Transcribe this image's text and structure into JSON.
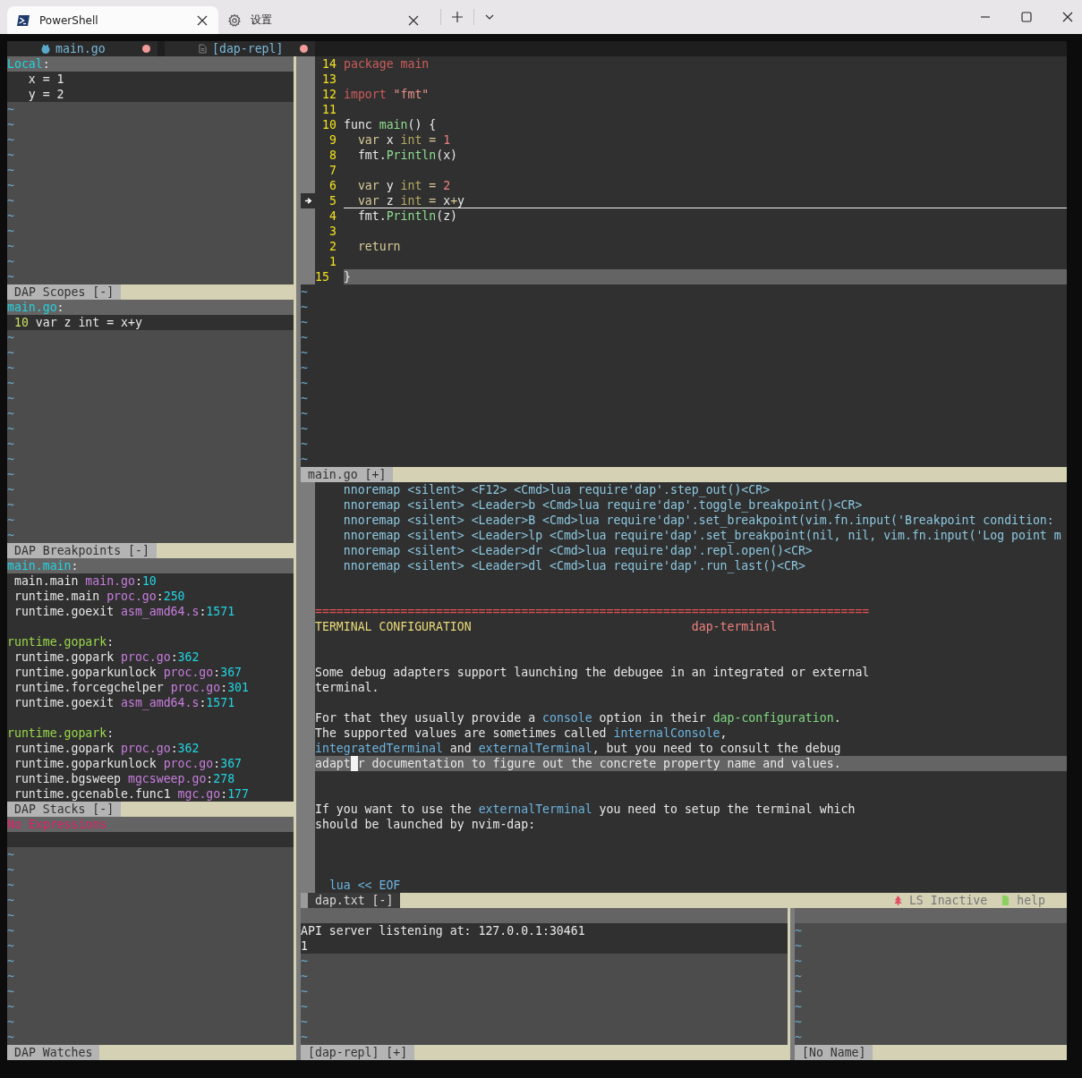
{
  "titlebar": {
    "tabs": [
      {
        "kind": "terminal",
        "label": "PowerShell",
        "selected": true
      },
      {
        "kind": "settings",
        "label": "设置",
        "selected": false
      }
    ]
  },
  "tabline": [
    {
      "kind": "go",
      "label": "main.go",
      "modified": true
    },
    {
      "kind": "doc",
      "label": "[dap-repl]",
      "modified": true
    }
  ],
  "left_panes": [
    {
      "lines": [
        {
          "segs": [
            {
              "t": "Local",
              "kind": "scope"
            },
            {
              "t": ":"
            }
          ],
          "cursorline": true
        },
        {
          "segs": [
            {
              "t": "   x = 1"
            }
          ],
          "cursorline": false
        },
        {
          "segs": [
            {
              "t": "   y = 2"
            }
          ],
          "cursorline": false
        }
      ],
      "filler": [
        "~",
        "~",
        "~",
        "~",
        "~",
        "~",
        "~",
        "~",
        "~",
        "~",
        "~",
        "~"
      ],
      "status": {
        "label": "DAP Scopes [-]",
        "active": false
      }
    },
    {
      "lines": [
        {
          "segs": [
            {
              "t": "main.go",
              "kind": "scope"
            },
            {
              "t": ":"
            }
          ],
          "cursorline": true
        },
        {
          "segs": [
            {
              "t": " 10",
              "kind": "lnr"
            },
            {
              "t": " var z int = x+y"
            }
          ],
          "cursorline": false
        }
      ],
      "filler": [
        "~",
        "~",
        "~",
        "~",
        "~",
        "~",
        "~",
        "~",
        "~",
        "~",
        "~",
        "~",
        "~",
        "~"
      ],
      "status": {
        "label": "DAP Breakpoints [-]",
        "active": false
      }
    },
    {
      "lines": [
        {
          "segs": [
            {
              "t": "main.main",
              "kind": "scope"
            },
            {
              "t": ":"
            }
          ],
          "cursorline": true
        },
        {
          "segs": [
            {
              "t": " main.main "
            },
            {
              "t": "main.go",
              "kind": "file"
            },
            {
              "t": ":"
            },
            {
              "t": "10",
              "kind": "lnum"
            }
          ],
          "cursorline": false
        },
        {
          "segs": [
            {
              "t": " runtime.main "
            },
            {
              "t": "proc.go",
              "kind": "file"
            },
            {
              "t": ":"
            },
            {
              "t": "250",
              "kind": "lnum"
            }
          ],
          "cursorline": false
        },
        {
          "segs": [
            {
              "t": " runtime.goexit "
            },
            {
              "t": "asm_amd64.s",
              "kind": "file"
            },
            {
              "t": ":"
            },
            {
              "t": "1571",
              "kind": "lnum"
            }
          ],
          "cursorline": false
        },
        {
          "cursorline": false
        },
        {
          "segs": [
            {
              "t": "runtime.gopark",
              "kind": "frame"
            },
            {
              "t": ":"
            }
          ],
          "cursorline": false
        },
        {
          "segs": [
            {
              "t": " runtime.gopark "
            },
            {
              "t": "proc.go",
              "kind": "file"
            },
            {
              "t": ":"
            },
            {
              "t": "362",
              "kind": "lnum"
            }
          ],
          "cursorline": false
        },
        {
          "segs": [
            {
              "t": " runtime.goparkunlock "
            },
            {
              "t": "proc.go",
              "kind": "file"
            },
            {
              "t": ":"
            },
            {
              "t": "367",
              "kind": "lnum"
            }
          ],
          "cursorline": false
        },
        {
          "segs": [
            {
              "t": " runtime.forcegchelper "
            },
            {
              "t": "proc.go",
              "kind": "file"
            },
            {
              "t": ":"
            },
            {
              "t": "301",
              "kind": "lnum"
            }
          ],
          "cursorline": false
        },
        {
          "segs": [
            {
              "t": " runtime.goexit "
            },
            {
              "t": "asm_amd64.s",
              "kind": "file"
            },
            {
              "t": ":"
            },
            {
              "t": "1571",
              "kind": "lnum"
            }
          ],
          "cursorline": false
        },
        {
          "cursorline": false
        },
        {
          "segs": [
            {
              "t": "runtime.gopark",
              "kind": "frame"
            },
            {
              "t": ":"
            }
          ],
          "cursorline": false
        },
        {
          "segs": [
            {
              "t": " runtime.gopark "
            },
            {
              "t": "proc.go",
              "kind": "file"
            },
            {
              "t": ":"
            },
            {
              "t": "362",
              "kind": "lnum"
            }
          ],
          "cursorline": false
        },
        {
          "segs": [
            {
              "t": " runtime.goparkunlock "
            },
            {
              "t": "proc.go",
              "kind": "file"
            },
            {
              "t": ":"
            },
            {
              "t": "367",
              "kind": "lnum"
            }
          ],
          "cursorline": false
        },
        {
          "segs": [
            {
              "t": " runtime.bgsweep "
            },
            {
              "t": "mgcsweep.go",
              "kind": "file"
            },
            {
              "t": ":"
            },
            {
              "t": "278",
              "kind": "lnum"
            }
          ],
          "cursorline": false
        },
        {
          "segs": [
            {
              "t": " runtime.gcenable.func1 "
            },
            {
              "t": "mgc.go",
              "kind": "file"
            },
            {
              "t": ":"
            },
            {
              "t": "177",
              "kind": "lnum"
            }
          ],
          "cursorline": false
        }
      ],
      "status": {
        "label": "DAP Stacks [-]",
        "active": false
      }
    },
    {
      "lines": [
        {
          "segs": [
            {
              "t": "No Expressions",
              "kind": "err"
            }
          ],
          "cursorline": true
        },
        {
          "cursorline": false
        }
      ],
      "filler": [
        "~",
        "~",
        "~",
        "~",
        "~",
        "~",
        "~",
        "~",
        "~",
        "~",
        "~",
        "~",
        "~"
      ],
      "status": {
        "label": "DAP Watches",
        "active": false
      }
    }
  ],
  "code_pane": {
    "lines": [
      {
        "num": "14",
        "segs": [
          {
            "t": "package main",
            "kind": "kw"
          }
        ],
        "cursorline": false,
        "stopped": false
      },
      {
        "num": "13",
        "cursorline": false,
        "stopped": false
      },
      {
        "num": "12",
        "segs": [
          {
            "t": "import ",
            "kind": "kw"
          },
          {
            "t": "\"fmt\"",
            "kind": "str"
          }
        ],
        "cursorline": false,
        "stopped": false
      },
      {
        "num": "11",
        "cursorline": false,
        "stopped": false
      },
      {
        "num": "10",
        "segs": [
          {
            "t": "func "
          },
          {
            "t": "main",
            "kind": "fn"
          },
          {
            "t": "() {"
          }
        ],
        "cursorline": false,
        "stopped": false
      },
      {
        "num": "9",
        "segs": [
          {
            "t": "  var",
            "kind": "key"
          },
          {
            "t": " x "
          },
          {
            "t": "int",
            "kind": "type"
          },
          {
            "t": " = ",
            "kind": "key"
          },
          {
            "t": "1",
            "kind": "num"
          }
        ],
        "cursorline": false,
        "stopped": false
      },
      {
        "num": "8",
        "segs": [
          {
            "t": "  fmt."
          },
          {
            "t": "Println",
            "kind": "fn"
          },
          {
            "t": "(x)"
          }
        ],
        "cursorline": false,
        "stopped": false
      },
      {
        "num": "7",
        "cursorline": false,
        "stopped": false
      },
      {
        "num": "6",
        "segs": [
          {
            "t": "  var",
            "kind": "key"
          },
          {
            "t": " y "
          },
          {
            "t": "int",
            "kind": "type"
          },
          {
            "t": " = ",
            "kind": "key"
          },
          {
            "t": "2",
            "kind": "num"
          }
        ],
        "cursorline": false,
        "stopped": false
      },
      {
        "num": "5",
        "segs": [
          {
            "t": "  var",
            "kind": "key"
          },
          {
            "t": " z "
          },
          {
            "t": "int",
            "kind": "type"
          },
          {
            "t": " = ",
            "kind": "key"
          },
          {
            "t": "x"
          },
          {
            "t": "+",
            "kind": "key"
          },
          {
            "t": "y"
          }
        ],
        "cursorline": false,
        "stopped": true
      },
      {
        "num": "4",
        "segs": [
          {
            "t": "  fmt."
          },
          {
            "t": "Println",
            "kind": "fn"
          },
          {
            "t": "(z)"
          }
        ],
        "cursorline": false,
        "stopped": false
      },
      {
        "num": "3",
        "cursorline": false,
        "stopped": false
      },
      {
        "num": "2",
        "segs": [
          {
            "t": "  return",
            "kind": "key"
          }
        ],
        "cursorline": false,
        "stopped": false
      },
      {
        "num": "1",
        "cursorline": false,
        "stopped": false
      },
      {
        "num": "15",
        "segs": [
          {
            "t": "}"
          }
        ],
        "cursorline": true,
        "stopped": false
      }
    ],
    "filler": [
      "~",
      "~",
      "~",
      "~",
      "~",
      "~",
      "~",
      "~",
      "~",
      "~",
      "~",
      "~"
    ],
    "status": {
      "label": "main.go [+]",
      "active": false
    }
  },
  "help_pane": {
    "lines": [
      {
        "segs": [
          {
            "t": "    nnoremap <silent> <F12> <Cmd>lua require'dap'.step_out()<CR>",
            "kind": "map"
          }
        ],
        "cursorline": false
      },
      {
        "segs": [
          {
            "t": "    nnoremap <silent> <Leader>b <Cmd>lua require'dap'.toggle_breakpoint()<CR>",
            "kind": "map"
          }
        ],
        "cursorline": false
      },
      {
        "segs": [
          {
            "t": "    nnoremap <silent> <Leader>B <Cmd>lua require'dap'.set_breakpoint(vim.fn.input('Breakpoint condition:",
            "kind": "map"
          }
        ],
        "cursorline": false
      },
      {
        "segs": [
          {
            "t": "    nnoremap <silent> <Leader>lp <Cmd>lua require'dap'.set_breakpoint(nil, nil, vim.fn.input('Log point m",
            "kind": "map"
          }
        ],
        "cursorline": false
      },
      {
        "segs": [
          {
            "t": "    nnoremap <silent> <Leader>dr <Cmd>lua require'dap'.repl.open()<CR>",
            "kind": "map"
          }
        ],
        "cursorline": false
      },
      {
        "segs": [
          {
            "t": "    nnoremap <silent> <Leader>dl <Cmd>lua require'dap'.run_last()<CR>",
            "kind": "map"
          }
        ],
        "cursorline": false
      },
      {
        "cursorline": false
      },
      {
        "cursorline": false
      },
      {
        "segs": [
          {
            "t": "==============================================================================",
            "kind": "sep"
          }
        ],
        "cursorline": false
      },
      {
        "segs": [
          {
            "t": "TERMINAL CONFIGURATION                               ",
            "kind": "title"
          },
          {
            "t": "dap-terminal",
            "kind": "tag"
          }
        ],
        "cursorline": false
      },
      {
        "cursorline": false
      },
      {
        "cursorline": false
      },
      {
        "segs": [
          {
            "t": "Some debug adapters support launching the debugee in an integrated or external"
          }
        ],
        "cursorline": false
      },
      {
        "segs": [
          {
            "t": "terminal."
          }
        ],
        "cursorline": false
      },
      {
        "cursorline": false
      },
      {
        "segs": [
          {
            "t": "For that they usually provide a "
          },
          {
            "t": "console",
            "kind": "link"
          },
          {
            "t": " option in their "
          },
          {
            "t": "dap-configuration",
            "kind": "hl"
          },
          {
            "t": "."
          }
        ],
        "cursorline": false
      },
      {
        "segs": [
          {
            "t": "The supported values are sometimes called "
          },
          {
            "t": "internalConsole",
            "kind": "link"
          },
          {
            "t": ","
          }
        ],
        "cursorline": false
      },
      {
        "segs": [
          {
            "t": "integratedTerminal",
            "kind": "link"
          },
          {
            "t": " and "
          },
          {
            "t": "externalTerminal",
            "kind": "link"
          },
          {
            "t": ", but you need to consult the debug"
          }
        ],
        "cursorline": false
      },
      {
        "segs": [
          {
            "t": "adapt"
          },
          {
            "kind": "cursor"
          },
          {
            "t": "r documentation to figure out the concrete property name and values."
          }
        ],
        "cursorline": true
      },
      {
        "cursorline": false
      },
      {
        "cursorline": false
      },
      {
        "segs": [
          {
            "t": "If you want to use the "
          },
          {
            "t": "externalTerminal",
            "kind": "link"
          },
          {
            "t": " you need to setup the terminal which"
          }
        ],
        "cursorline": false
      },
      {
        "segs": [
          {
            "t": "should be launched by nvim-dap:"
          }
        ],
        "cursorline": false
      },
      {
        "cursorline": false
      },
      {
        "cursorline": false
      },
      {
        "cursorline": false
      },
      {
        "segs": [
          {
            "t": "  lua << EOF",
            "kind": "link"
          }
        ],
        "cursorline": false
      }
    ],
    "status": {
      "label": "dap.txt [-]",
      "active": true,
      "right": [
        {
          "kind": "tree",
          "text": "LS Inactive"
        },
        {
          "kind": "file",
          "text": "help"
        }
      ]
    }
  },
  "bottom_panes": [
    {
      "lines": [
        {
          "cursorline": true
        },
        {
          "segs": [
            {
              "t": "API server listening at: 127.0.0.1:30461"
            }
          ],
          "cursorline": false
        },
        {
          "segs": [
            {
              "t": "1"
            }
          ],
          "cursorline": false
        }
      ],
      "filler": [
        "~",
        "~",
        "~",
        "~",
        "~",
        "~"
      ],
      "status": {
        "label": "[dap-repl] [+]",
        "active": false
      }
    },
    {
      "lines": [
        {
          "cursorline": true
        }
      ],
      "filler": [
        "~",
        "~",
        "~",
        "~",
        "~",
        "~",
        "~",
        "~"
      ],
      "status": {
        "label": "[No Name]",
        "active": false
      }
    }
  ]
}
